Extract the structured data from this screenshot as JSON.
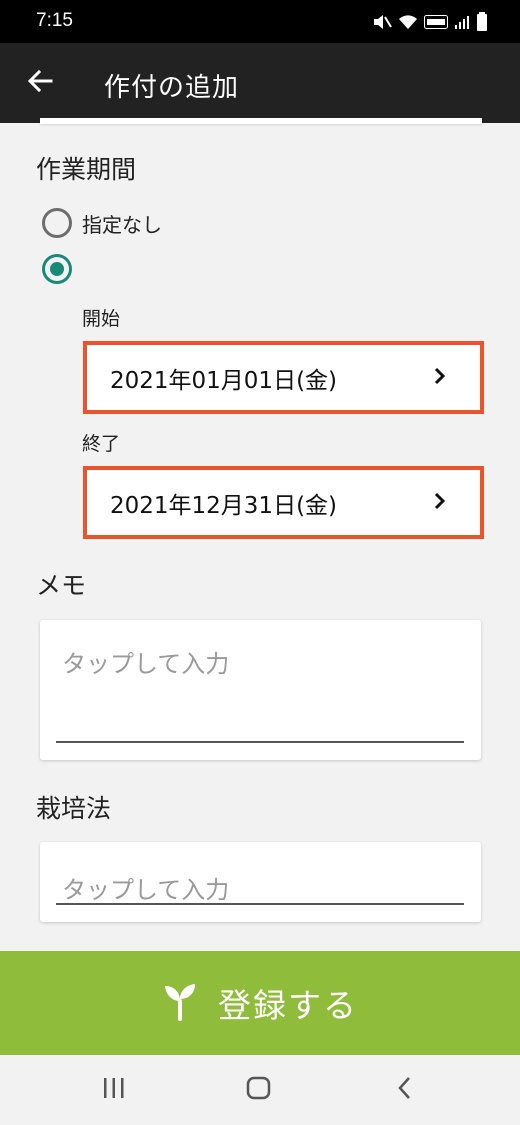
{
  "status_bar": {
    "time": "7:15"
  },
  "app_bar": {
    "title": "作付の追加"
  },
  "period": {
    "label": "作業期間",
    "option_none_label": "指定なし",
    "start_label": "開始",
    "start_value": "2021年01月01日(金)",
    "end_label": "終了",
    "end_value": "2021年12月31日(金)"
  },
  "memo": {
    "label": "メモ",
    "placeholder": "タップして入力"
  },
  "cultivation": {
    "label": "栽培法",
    "placeholder": "タップして入力"
  },
  "register_button": {
    "label": "登録する",
    "color": "#8fbc3a"
  },
  "colors": {
    "accent": "#1a8a78",
    "highlight": "#e8542b"
  }
}
